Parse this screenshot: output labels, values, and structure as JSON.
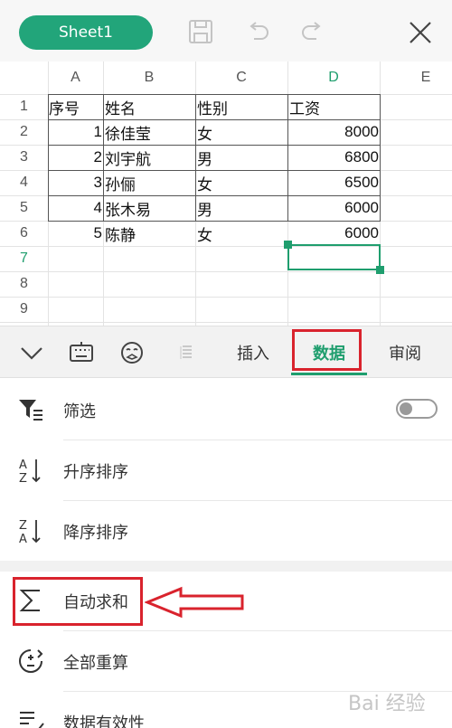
{
  "topbar": {
    "sheet_tab": "Sheet1",
    "icons": [
      "save-icon",
      "undo-icon",
      "redo-icon",
      "close-icon"
    ]
  },
  "sheet": {
    "columns": [
      "A",
      "B",
      "C",
      "D",
      "E"
    ],
    "active_column": "D",
    "rows": [
      "1",
      "2",
      "3",
      "4",
      "5",
      "6",
      "7",
      "8",
      "9"
    ],
    "active_row": "7",
    "header_row": [
      "序号",
      "姓名",
      "性别",
      "工资"
    ],
    "data": [
      [
        "1",
        "徐佳莹",
        "女",
        "8000"
      ],
      [
        "2",
        "刘宇航",
        "男",
        "6800"
      ],
      [
        "3",
        "孙俪",
        "女",
        "6500"
      ],
      [
        "4",
        "张木易",
        "男",
        "6000"
      ],
      [
        "5",
        "陈静",
        "女",
        "6000"
      ]
    ],
    "selected_cell": "D7"
  },
  "ribbon": {
    "tabs": [
      "插入",
      "数据",
      "审阅"
    ],
    "active_tab": "数据",
    "icons": [
      "collapse-chevron-icon",
      "keyboard-icon",
      "emoji-icon",
      "format-icon"
    ]
  },
  "menu": {
    "filter": "筛选",
    "filter_on": false,
    "sort_asc": "升序排序",
    "sort_desc": "降序排序",
    "autosum": "自动求和",
    "recalc_all": "全部重算",
    "data_validation": "数据有效性"
  },
  "watermark": "Bai 经验",
  "colors": {
    "accent": "#1f9e6e",
    "highlight": "#d9232d"
  }
}
